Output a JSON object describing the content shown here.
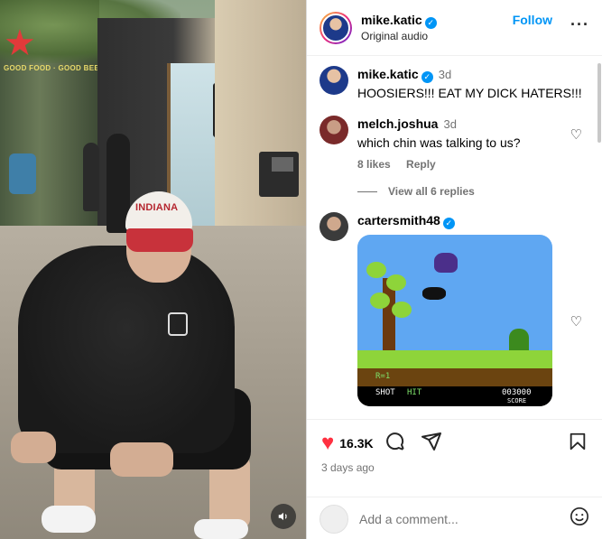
{
  "post": {
    "username": "mike.katic",
    "audio": "Original audio",
    "follow_label": "Follow",
    "more_icon": "more-dots-icon"
  },
  "video": {
    "sign_text": "GOOD FOOD · GOOD BEER",
    "hat_text": "INDIANA",
    "mute_icon": "speaker-icon"
  },
  "comments": [
    {
      "username": "mike.katic",
      "verified": true,
      "time": "3d",
      "text": "HOOSIERS!!! EAT MY DICK HATERS!!!"
    },
    {
      "username": "melch.joshua",
      "verified": false,
      "time": "3d",
      "text": "which chin was talking to us?",
      "likes": "8 likes",
      "reply_label": "Reply",
      "view_replies": "View all 6 replies"
    },
    {
      "username": "cartersmith48",
      "verified": true,
      "time": "",
      "gif": {
        "round": "R=1",
        "shot": "SHOT",
        "hit": "HIT",
        "score": "003000",
        "score_label": "SCORE"
      }
    }
  ],
  "actions": {
    "like_count": "16.3K",
    "date": "3 days ago",
    "add_comment_placeholder": "Add a comment..."
  },
  "colors": {
    "accent_blue": "#0095f6",
    "like_red": "#ff3040",
    "muted_text": "#737373"
  }
}
